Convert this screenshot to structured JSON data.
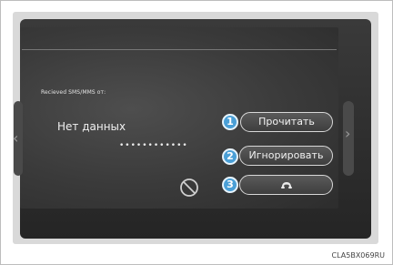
{
  "screen": {
    "message_title": "Recieved SMS/MMS от:",
    "no_data_text": "Нет данных",
    "number_mask": "••••••••••••",
    "buttons": [
      {
        "index": "1",
        "label": "Прочитать"
      },
      {
        "index": "2",
        "label": "Игнорировать"
      },
      {
        "index": "3",
        "icon": "phone-handset-icon"
      }
    ],
    "disabled_icon": "no-entry-icon",
    "side_icons": [
      "chevron-left-icon",
      "chevron-right-icon"
    ]
  },
  "figure_code": "CLA5BX069RU",
  "colors": {
    "badge": "#4a9fd6",
    "screen": "#3a3a3a",
    "button_border": "#d8d8d8"
  }
}
